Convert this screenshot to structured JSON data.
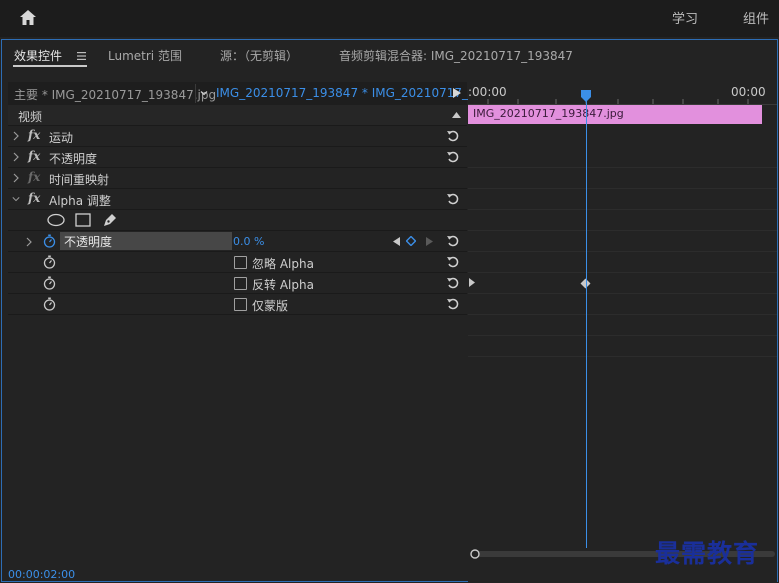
{
  "topbar": {
    "nav": [
      "学习",
      "组件"
    ]
  },
  "panel_tabs": {
    "effects": "效果控件",
    "lumetri": "Lumetri 范围",
    "source": "源：（无剪辑）",
    "mixer": "音频剪辑混合器: IMG_20210717_193847"
  },
  "sequence": {
    "master": "主要 * IMG_20210717_193847.jpg",
    "clip": "IMG_20210717_193847 * IMG_20210717_..."
  },
  "effects": {
    "video_header": "视频",
    "motion": "运动",
    "opacity": "不透明度",
    "time_remap": "时间重映射",
    "alpha_adjust": "Alpha 调整",
    "alpha_opacity_label": "不透明度",
    "alpha_opacity_value": "0.0 %",
    "ignore_alpha": "忽略 Alpha",
    "invert_alpha": "反转 Alpha",
    "mask_only": "仅蒙版"
  },
  "timeline": {
    "start_tc": ":00:00",
    "end_tc": "00:00",
    "clip_name": "IMG_20210717_193847.jpg"
  },
  "footer": {
    "timecode": "00:00:02:00"
  },
  "watermark": "最需教育",
  "colors": {
    "accent": "#3b8fe8",
    "clip": "#e290dd",
    "panel_border": "#2d6db5"
  }
}
